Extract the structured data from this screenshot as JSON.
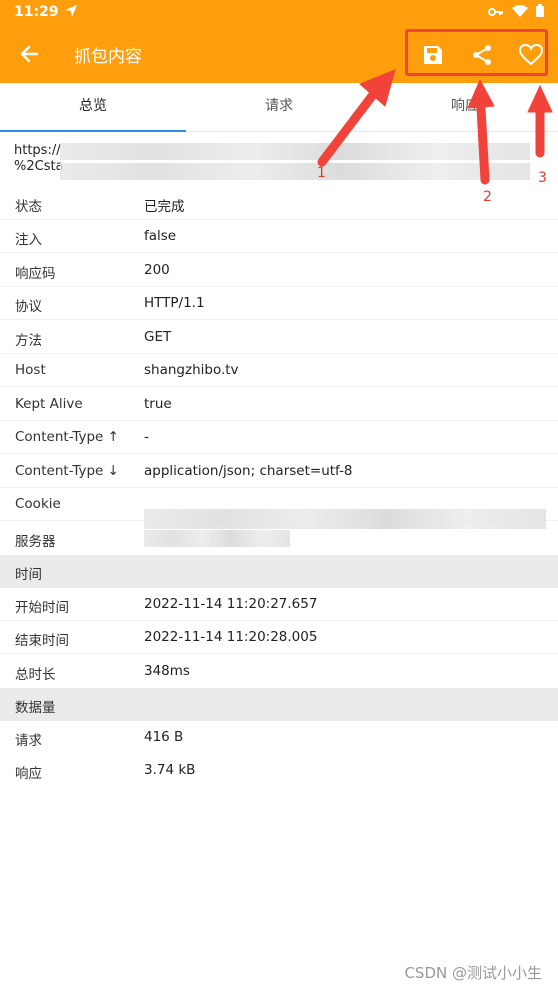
{
  "status_bar": {
    "time": "11:29"
  },
  "toolbar": {
    "title": "抓包内容"
  },
  "tabs": [
    {
      "label": "总览"
    },
    {
      "label": "请求"
    },
    {
      "label": "响应"
    }
  ],
  "url": {
    "line1": "https://",
    "line2": "%2Csta"
  },
  "rows": [
    {
      "key": "状态",
      "value": "已完成"
    },
    {
      "key": "注入",
      "value": "false"
    },
    {
      "key": "响应码",
      "value": "200"
    },
    {
      "key": "协议",
      "value": "HTTP/1.1"
    },
    {
      "key": "方法",
      "value": "GET"
    },
    {
      "key": "Host",
      "value": "shangzhibo.tv"
    },
    {
      "key": "Kept Alive",
      "value": "true"
    },
    {
      "key": "Content-Type ↑",
      "value": "-"
    },
    {
      "key": "Content-Type ↓",
      "value": "application/json; charset=utf-8"
    },
    {
      "key": "Cookie",
      "value": ""
    },
    {
      "key": "服务器",
      "value": ""
    }
  ],
  "time_section": {
    "title": "时间",
    "rows": [
      {
        "key": "开始时间",
        "value": "2022-11-14 11:20:27.657"
      },
      {
        "key": "结束时间",
        "value": "2022-11-14 11:20:28.005"
      },
      {
        "key": "总时长",
        "value": "348ms"
      }
    ]
  },
  "data_section": {
    "title": "数据量",
    "rows": [
      {
        "key": "请求",
        "value": "416 B"
      },
      {
        "key": "响应",
        "value": "3.74 kB"
      }
    ]
  },
  "annotations": [
    "1",
    "2",
    "3"
  ],
  "watermark": "CSDN @测试小小生",
  "colors": {
    "toolbar": "#FF9E0D",
    "tab_indicator": "#2F8BE6",
    "annotation": "#F2433A"
  }
}
